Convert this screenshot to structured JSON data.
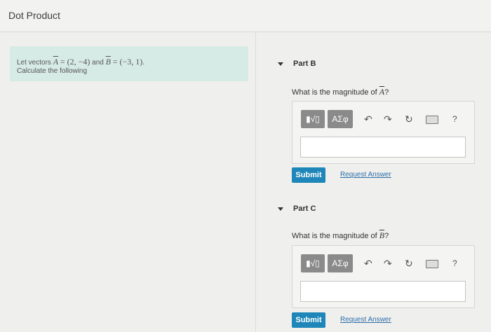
{
  "header": {
    "title": "Dot Product"
  },
  "intro": {
    "line1_prefix": "Let vectors",
    "vec_a": "A",
    "eq_a": "= (2, −4)",
    "and_word": "and",
    "vec_b": "B",
    "eq_b": "= (−3, 1).",
    "line2": "Calculate the following"
  },
  "toolbar": {
    "templates_label": "▮√▯",
    "greek_label": "ΑΣφ",
    "help_label": "?"
  },
  "parts": [
    {
      "label": "Part B",
      "question_prefix": "What is the magnitude of",
      "question_var": "A",
      "question_suffix": "?",
      "submit_label": "Submit",
      "request_label": "Request Answer"
    },
    {
      "label": "Part C",
      "question_prefix": "What is the magnitude of",
      "question_var": "B",
      "question_suffix": "?",
      "submit_label": "Submit",
      "request_label": "Request Answer"
    }
  ]
}
